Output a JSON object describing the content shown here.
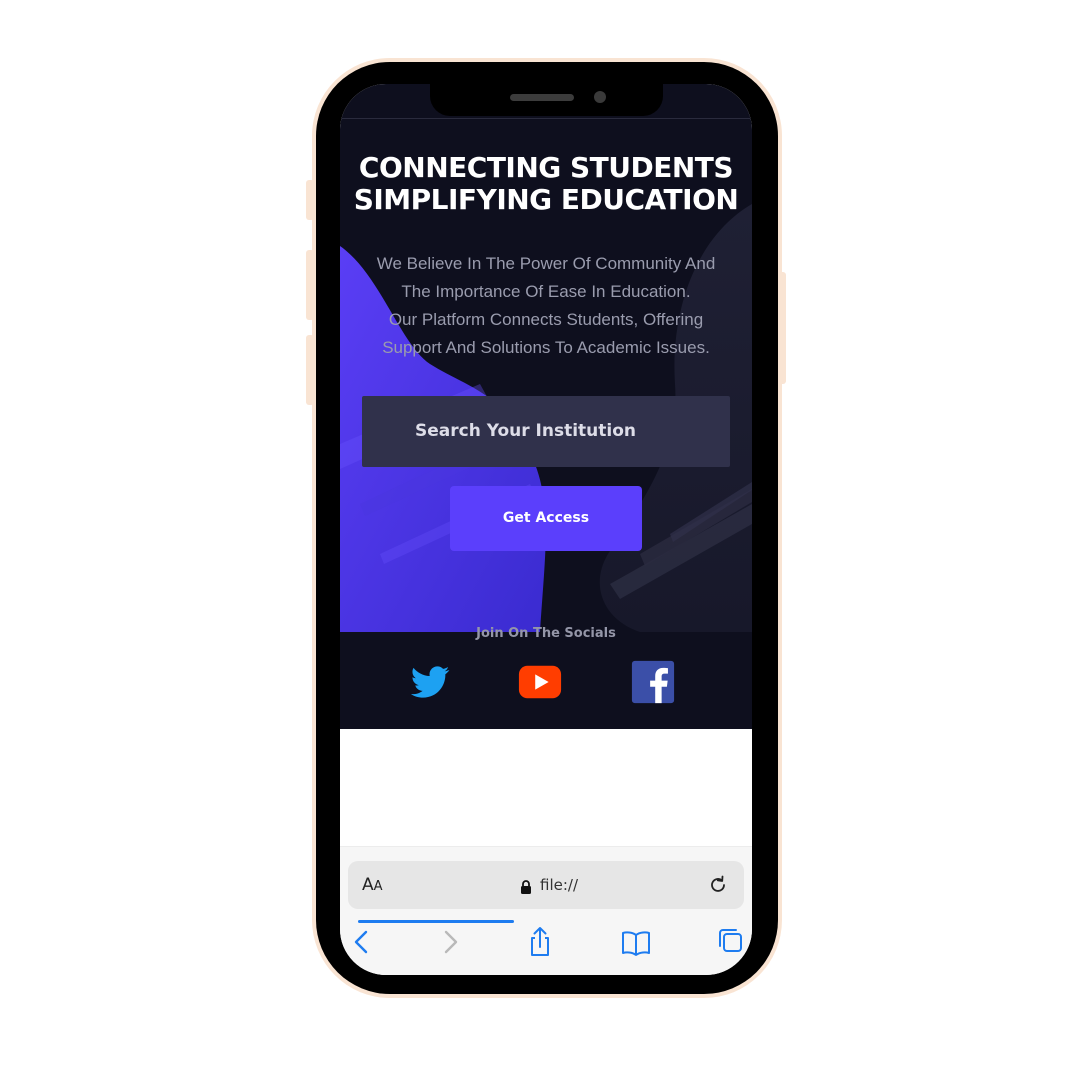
{
  "hero": {
    "headline_line1": "CONNECTING STUDENTS",
    "headline_line2": "SIMPLIFYING EDUCATION",
    "description_lines": [
      "We Believe In The Power Of Community And",
      "The Importance Of Ease In Education.",
      "Our Platform Connects Students, Offering",
      "Support And Solutions To Academic Issues."
    ],
    "search_label": "Search Your Institution",
    "cta_label": "Get Access"
  },
  "socials": {
    "title": "Join On The Socials",
    "items": [
      {
        "icon": "twitter-icon",
        "color": "#1da1f2"
      },
      {
        "icon": "youtube-icon",
        "color": "#ff3d00"
      },
      {
        "icon": "facebook-icon",
        "color": "#3b5998"
      }
    ]
  },
  "browser": {
    "text_size_label_big": "A",
    "text_size_label_small": "A",
    "url": "file://",
    "accent_color": "#1e7cf0"
  },
  "colors": {
    "phone_frame": "#f9e4d3",
    "hero_background": "#0e0f1e",
    "accent": "#5b3ffc",
    "search_box": "#30314b"
  }
}
